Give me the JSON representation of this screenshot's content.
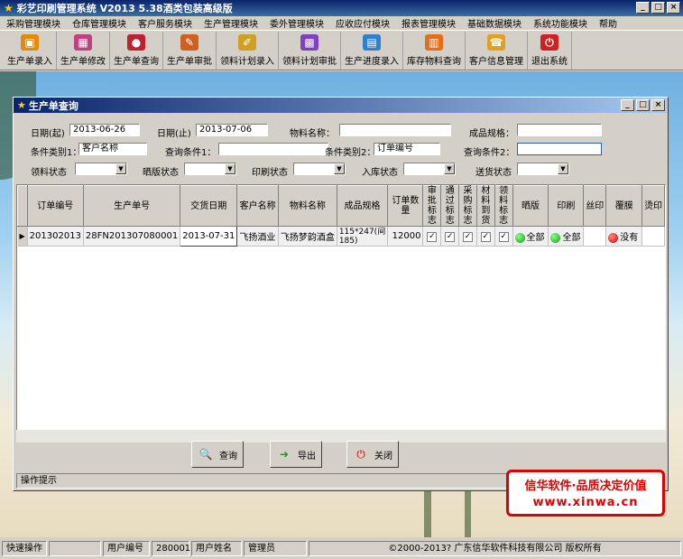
{
  "window": {
    "title": "彩艺印刷管理系统  V2013 5.38酒类包装高级版",
    "min": "_",
    "max": "□",
    "close": "×"
  },
  "menu": [
    "采购管理模块",
    "仓库管理模块",
    "客户服务模块",
    "生产管理模块",
    "委外管理模块",
    "应收应付模块",
    "报表管理模块",
    "基础数据模块",
    "系统功能模块",
    "帮助"
  ],
  "toolbar": [
    {
      "label": "生产单录入",
      "icon": "box-icon",
      "color": "#e08a10",
      "glyph": "▣"
    },
    {
      "label": "生产单修改",
      "icon": "gift-icon",
      "color": "#c04080",
      "glyph": "▦"
    },
    {
      "label": "生产单查询",
      "icon": "cherries-icon",
      "color": "#c02030",
      "glyph": "●"
    },
    {
      "label": "生产单审批",
      "icon": "stamp-icon",
      "color": "#d06020",
      "glyph": "✎"
    },
    {
      "label": "领料计划录入",
      "icon": "pen-icon",
      "color": "#d0a020",
      "glyph": "✐"
    },
    {
      "label": "领料计划审批",
      "icon": "cubes-icon",
      "color": "#8040c0",
      "glyph": "▩"
    },
    {
      "label": "生产进度录入",
      "icon": "chart-icon",
      "color": "#3080d0",
      "glyph": "▤"
    },
    {
      "label": "库存物料查询",
      "icon": "warehouse-icon",
      "color": "#e07020",
      "glyph": "▥"
    },
    {
      "label": "客户信息管理",
      "icon": "contact-icon",
      "color": "#e0a020",
      "glyph": "☎"
    },
    {
      "label": "退出系统",
      "icon": "power-icon",
      "color": "#d02020",
      "glyph": "⏻"
    }
  ],
  "dialog": {
    "title": "生产单查询"
  },
  "form": {
    "date_from_label": "日期(起)",
    "date_from": "2013-06-26",
    "date_to_label": "日期(止)",
    "date_to": "2013-07-06",
    "material_label": "物料名称：",
    "material": "",
    "spec_label": "成品规格：",
    "spec": "",
    "cond1_label": "条件类别1：",
    "cond1": "客户名称",
    "query1_label": "查询条件1：",
    "query1": "",
    "cond2_label": "条件类别2：",
    "cond2": "订单编号",
    "query2_label": "查询条件2：",
    "query2": "",
    "s1_label": "领料状态",
    "s2_label": "晒版状态",
    "s3_label": "印刷状态",
    "s4_label": "入库状态",
    "s5_label": "送货状态"
  },
  "table": {
    "headers": [
      "订单编号",
      "生产单号",
      "交货日期",
      "客户名称",
      "物料名称",
      "成品规格",
      "订单数量",
      "审批标志",
      "通过标志",
      "采购标志",
      "材料到货",
      "领料标志",
      "晒版",
      "印刷",
      "丝印",
      "覆膜",
      "烫印"
    ],
    "rows": [
      {
        "order": "201302013",
        "prod": "28FN201307080001",
        "date": "2013-07-31",
        "customer": "飞扬酒业",
        "material": "飞扬梦韵酒盒",
        "spec": "115*247(间185)",
        "qty": "12000",
        "c1": "✓",
        "c2": "✓",
        "c3": "✓",
        "c4": "✓",
        "c5": "✓",
        "ban": "全部",
        "print": "全部",
        "silk": "",
        "film": "没有",
        "hot": ""
      }
    ]
  },
  "buttons": {
    "query": "查询",
    "export": "导出",
    "close": "关闭"
  },
  "tip": "操作提示",
  "ad": {
    "line1": "信华软件·品质决定价值",
    "line2": "www.xinwa.cn"
  },
  "status": {
    "quick": "快速操作",
    "user_no_label": "用户编号",
    "user_no": "280001",
    "user_name_label": "用户姓名",
    "user_name": "管理员",
    "copyright": "©2000-2013? 广东信华软件科技有限公司  版权所有"
  },
  "colors": {
    "title": "#0a246a",
    "green": "#1a9a1a",
    "red": "#d00000"
  }
}
